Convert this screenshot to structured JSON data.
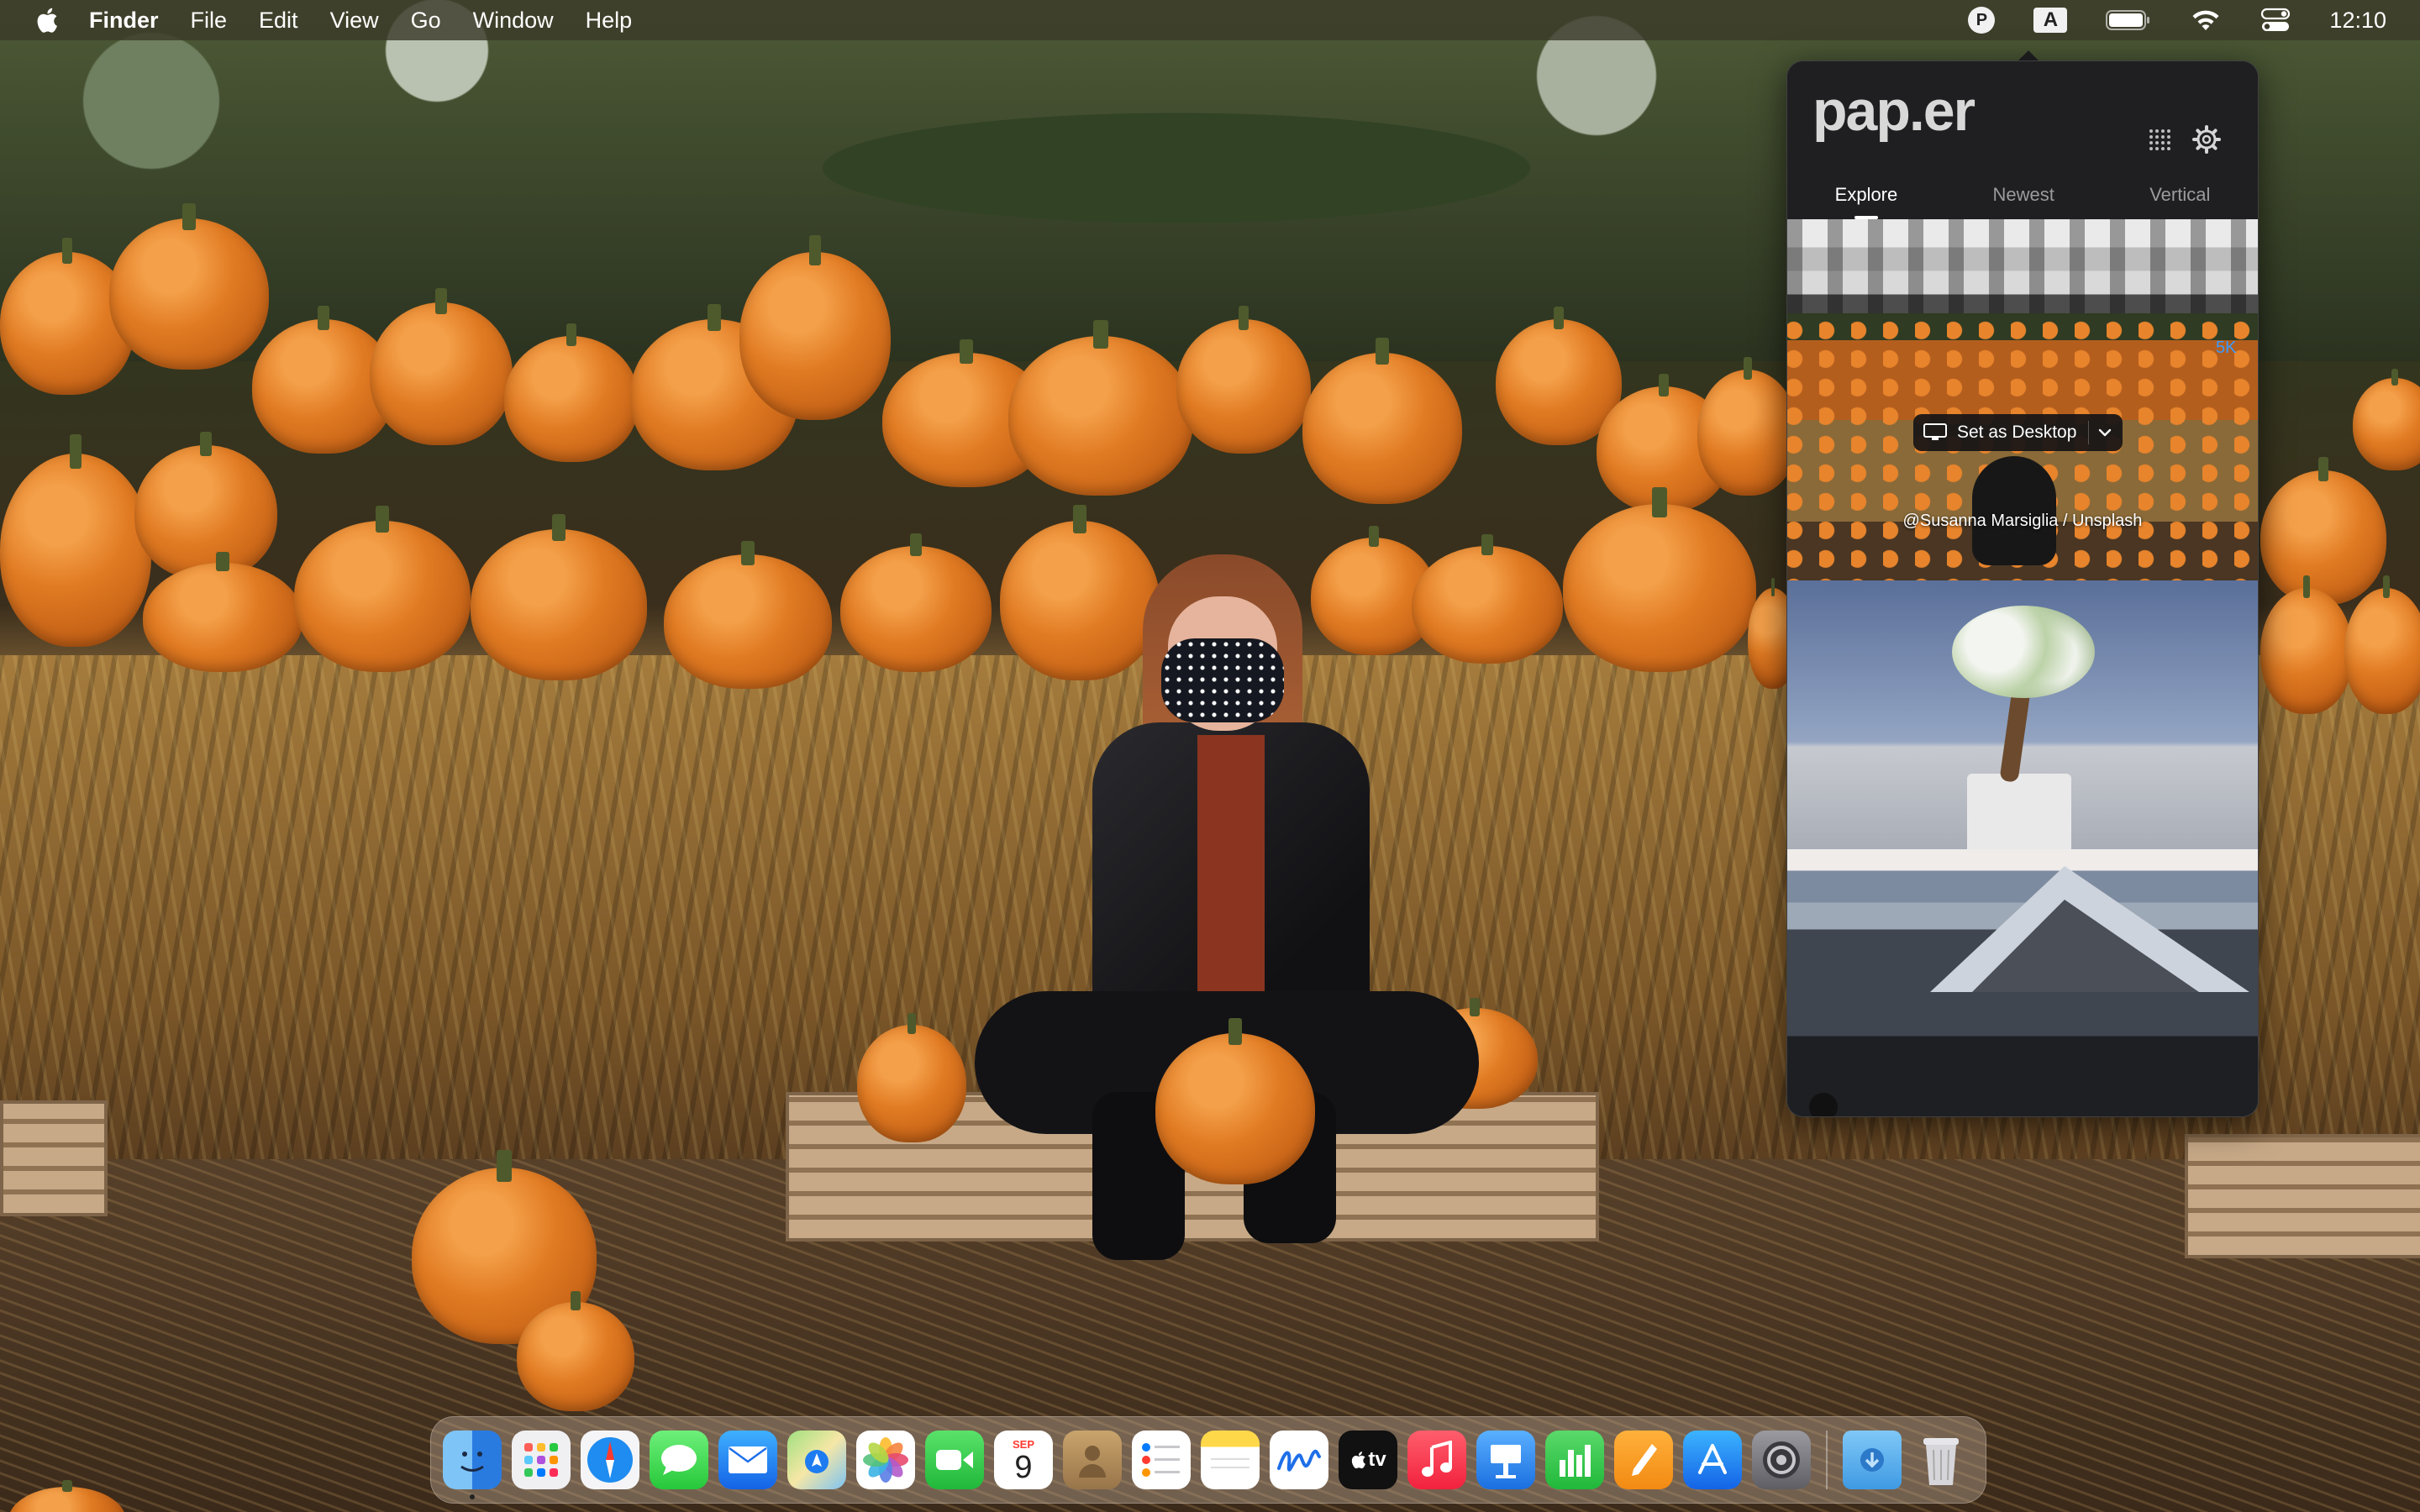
{
  "menubar": {
    "app_name": "Finder",
    "menus": [
      "File",
      "Edit",
      "View",
      "Go",
      "Window",
      "Help"
    ],
    "status": {
      "paper_badge": "P",
      "input_source": "A",
      "clock": "12:10"
    }
  },
  "paper": {
    "logo": "pap.er",
    "tabs": [
      "Explore",
      "Newest",
      "Vertical"
    ],
    "active_tab": "Explore",
    "featured": {
      "resolution_badge": "5K",
      "set_desktop_label": "Set as Desktop",
      "credit": "@Susanna Marsiglia / Unsplash"
    },
    "thumbnails": [
      "building",
      "pumpkins",
      "bonsai-tree",
      "volcano"
    ]
  },
  "dock": {
    "calendar_month": "SEP",
    "calendar_day": "9",
    "tv_label": "tv",
    "apps": [
      "Finder",
      "Launchpad",
      "Safari",
      "Messages",
      "Mail",
      "Maps",
      "Photos",
      "FaceTime",
      "Calendar",
      "Contacts",
      "Reminders",
      "Notes",
      "Freeform",
      "TV",
      "Music",
      "Keynote",
      "Numbers",
      "Pages",
      "App Store",
      "System Settings",
      "Downloads",
      "Trash"
    ]
  }
}
